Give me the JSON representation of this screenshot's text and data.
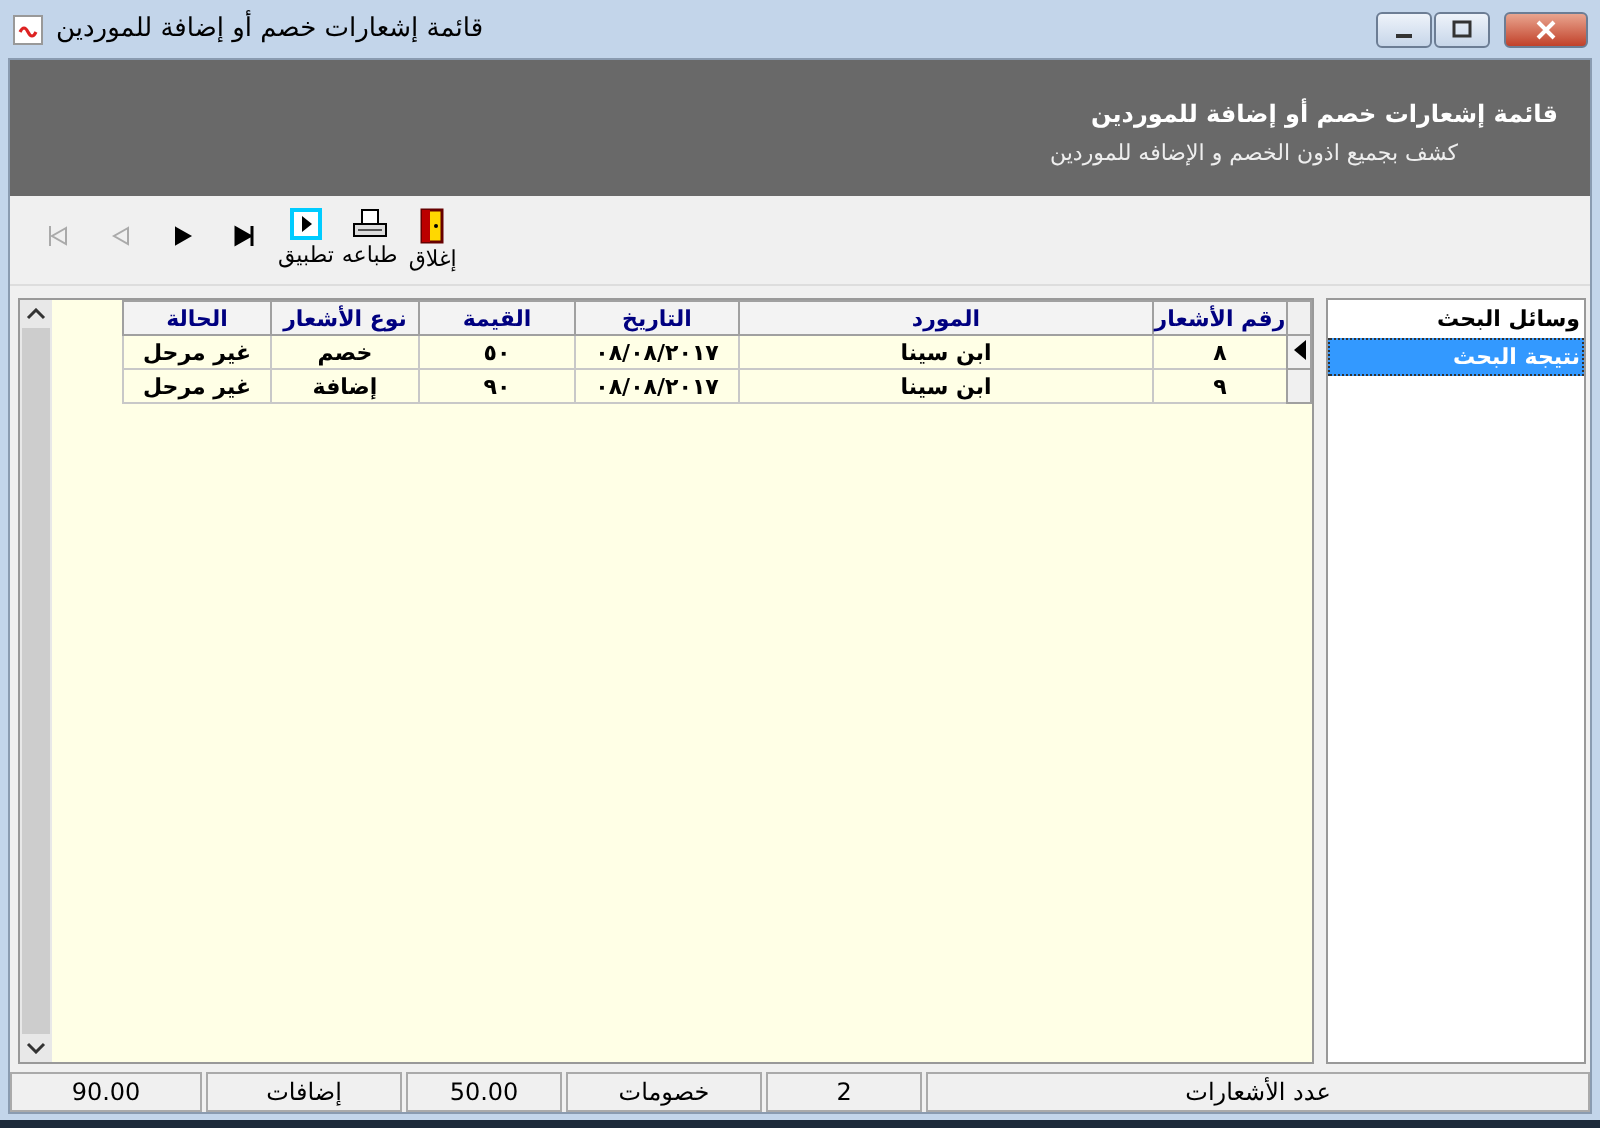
{
  "window": {
    "title": "قائمة إشعارات خصم أو إضافة للموردين"
  },
  "header": {
    "title": "قائمة إشعارات خصم أو إضافة للموردين",
    "subtitle": "كشف بجميع اذون الخصم و الإضافه للموردين"
  },
  "toolbar": [
    {
      "kind": "close",
      "label": "إغلاق",
      "disabled": false
    },
    {
      "kind": "print",
      "label": "طباعه",
      "disabled": false
    },
    {
      "kind": "apply",
      "label": "تطبيق",
      "disabled": false
    },
    {
      "kind": "last",
      "disabled": false
    },
    {
      "kind": "next",
      "disabled": false
    },
    {
      "kind": "prev",
      "disabled": true
    },
    {
      "kind": "first",
      "disabled": true
    }
  ],
  "sidebar": {
    "items": [
      {
        "label": "وسائل البحث",
        "selected": false
      },
      {
        "label": "نتيجة البحث",
        "selected": true
      }
    ]
  },
  "table": {
    "columns": [
      "رقم الأشعار",
      "المورد",
      "التاريخ",
      "القيمة",
      "نوع الأشعار",
      "الحالة"
    ],
    "rows": [
      {
        "selected": true,
        "cells": [
          "٨",
          "ابن سينا",
          "٠٨/٠٨/٢٠١٧",
          "٥٠",
          "خصم",
          "غير مرحل"
        ]
      },
      {
        "selected": false,
        "cells": [
          "٩",
          "ابن سينا",
          "٠٨/٠٨/٢٠١٧",
          "٩٠",
          "إضافة",
          "غير مرحل"
        ]
      }
    ]
  },
  "status_bar": [
    "عدد الأشعارات",
    "2",
    "خصومات",
    "50.00",
    "إضافات",
    "90.00"
  ]
}
